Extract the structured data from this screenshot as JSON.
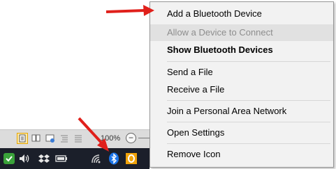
{
  "context_menu": {
    "items": [
      {
        "label": "Add a Bluetooth Device",
        "state": "normal"
      },
      {
        "label": "Allow a Device to Connect",
        "state": "disabled"
      },
      {
        "label": "Show Bluetooth Devices",
        "state": "default-bold"
      },
      {
        "label": "Send a File",
        "state": "normal"
      },
      {
        "label": "Receive a File",
        "state": "normal"
      },
      {
        "label": "Join a Personal Area Network",
        "state": "normal"
      },
      {
        "label": "Open Settings",
        "state": "normal"
      },
      {
        "label": "Remove Icon",
        "state": "normal"
      }
    ]
  },
  "status_bar": {
    "zoom_level": "100%",
    "zoom_minus_symbol": "−"
  },
  "tray": {
    "icons": [
      "shield-check-icon",
      "volume-icon",
      "dropbox-icon",
      "battery-icon",
      "wifi-icon",
      "bluetooth-icon",
      "outlook-icon"
    ]
  },
  "colors": {
    "arrow": "#e0201b",
    "menu_bg": "#f2f2f2",
    "tray_bg": "#1b1f2a",
    "bluetooth_blue": "#1a73e8"
  }
}
